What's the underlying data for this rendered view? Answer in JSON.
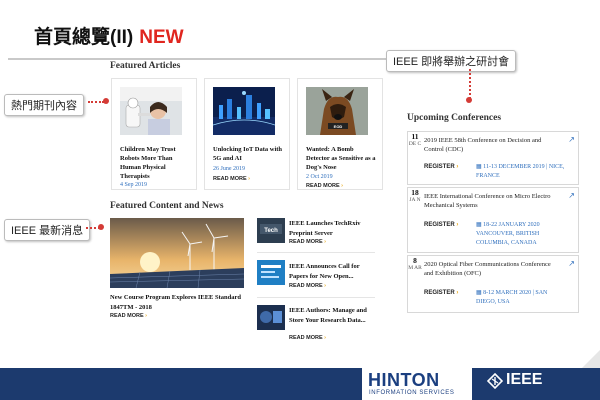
{
  "header": {
    "title": "首頁總覽(II)",
    "new_badge": "NEW"
  },
  "callouts": {
    "featured_articles": "熱門期刊內容",
    "ieee_news": "IEEE 最新消息",
    "ieee_conferences": "IEEE 即將舉辦之研討會"
  },
  "featured_articles": {
    "heading": "Featured Articles",
    "items": [
      {
        "title": "Children May Trust Robots More Than Human Physical Therapists",
        "date": "4 Sep 2019",
        "more": "READ MORE"
      },
      {
        "title": "Unlocking IoT Data with 5G and AI",
        "date": "26 June 2019",
        "more": "READ MORE"
      },
      {
        "title": "Wanted: A Bomb Detector as Sensitive as a Dog's Nose",
        "date": "2 Oct 2019",
        "more": "READ MORE"
      }
    ]
  },
  "featured_content": {
    "heading": "Featured Content and News",
    "main": {
      "title": "New Course Program Explores IEEE Standard 1847TM - 2018",
      "more": "READ MORE"
    },
    "news": [
      {
        "title": "IEEE Launches TechRxiv Preprint Server",
        "more": "READ MORE"
      },
      {
        "title": "IEEE Announces Call for Papers for New Open...",
        "more": "READ MORE"
      },
      {
        "title": "IEEE Authors: Manage and Store Your Research Data...",
        "more": "READ MORE"
      }
    ]
  },
  "conferences": {
    "heading": "Upcoming Conferences",
    "items": [
      {
        "day": "11",
        "mon": "DE C",
        "name": "2019 IEEE 58th Conference on Decision and Control (CDC)",
        "register": "REGISTER",
        "when": "11-13 DECEMBER 2019 | NICE, FRANCE"
      },
      {
        "day": "18",
        "mon": "JA N",
        "name": "IEEE International Conference on Micro Electro Mechanical Systems",
        "register": "REGISTER",
        "when": "18-22 JANUARY 2020 VANCOUVER, BRITISH COLUMBIA, CANADA"
      },
      {
        "day": "8",
        "mon": "M AR",
        "name": "2020 Optical Fiber Communications Conference and Exhibition (OFC)",
        "register": "REGISTER",
        "when": "8-12 MARCH 2020 | SAN DIEGO, USA"
      }
    ]
  },
  "footer": {
    "hinton": "HINTON",
    "hinton_sub": "INFORMATION SERVICES",
    "ieee": "IEEE"
  },
  "colors": {
    "accent_red": "#e0261f",
    "link_blue": "#2f6fbd",
    "footer_navy": "#1c3a6e"
  }
}
